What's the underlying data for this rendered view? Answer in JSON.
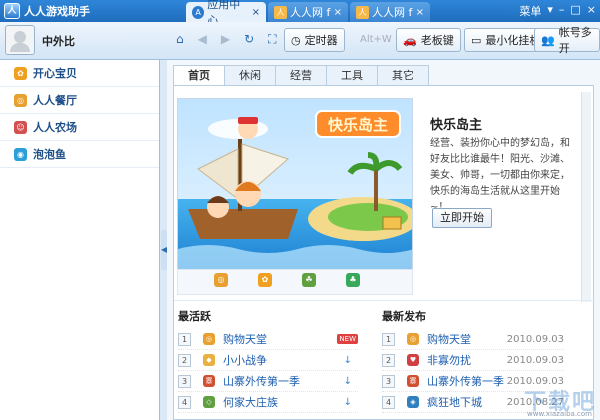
{
  "app": {
    "title": "人人游戏助手"
  },
  "tabs": [
    {
      "label": "应用中心",
      "close": "×"
    },
    {
      "label": "人人网 f",
      "close": "×"
    },
    {
      "label": "人人网 f",
      "close": "×"
    }
  ],
  "window_controls": {
    "menu": "菜单",
    "minimize": "–",
    "maximize": "□",
    "close": "×"
  },
  "toolbar": {
    "username": "中外比",
    "timer_label": "定时器",
    "hotkey_hint": "Alt+W",
    "boss_key_label": "老板键",
    "minimize_hang_label": "最小化挂机",
    "multi_account_label": "帐号多开"
  },
  "sidebar": {
    "items": [
      {
        "label": "开心宝贝",
        "icon_color": "#f0a020"
      },
      {
        "label": "人人餐厅",
        "icon_color": "#e8a030"
      },
      {
        "label": "人人农场",
        "icon_color": "#d25050"
      },
      {
        "label": "泡泡鱼",
        "icon_color": "#2a9fd8"
      }
    ]
  },
  "content_tabs": [
    "首页",
    "休闲",
    "经营",
    "工具",
    "其它"
  ],
  "featured": {
    "banner_text": "快乐岛主",
    "title": "快乐岛主",
    "description": "经营、装扮你心中的梦幻岛，和好友比比谁最牛！阳光、沙滩、美女、帅哥，一切都由你来定，快乐的海岛生活就从这里开始~！",
    "start_button": "立即开始"
  },
  "most_active": {
    "title": "最活跃",
    "rows": [
      {
        "num": "1",
        "name": "购物天堂",
        "badge": "NEW",
        "icon_color": "#e8a030"
      },
      {
        "num": "2",
        "name": "小小战争",
        "arrow": "↓",
        "icon_color": "#e8b040"
      },
      {
        "num": "3",
        "name": "山寨外传第一季",
        "arrow": "↓",
        "icon_color": "#d05030"
      },
      {
        "num": "4",
        "name": "何家大庄族",
        "arrow": "↓",
        "icon_color": "#60a040"
      }
    ]
  },
  "latest": {
    "title": "最新发布",
    "rows": [
      {
        "num": "1",
        "name": "购物天堂",
        "date": "2010.09.03",
        "icon_color": "#e8a030"
      },
      {
        "num": "2",
        "name": "非寡勿扰",
        "date": "2010.09.03",
        "icon_color": "#d04040"
      },
      {
        "num": "3",
        "name": "山寨外传第一季",
        "date": "2010.09.03",
        "icon_color": "#d05030"
      },
      {
        "num": "4",
        "name": "疯狂地下城",
        "date": "2010.08.27",
        "icon_color": "#3080c0"
      }
    ]
  },
  "watermark": {
    "text": "下载吧",
    "url": "www.xiazaiba.com"
  }
}
